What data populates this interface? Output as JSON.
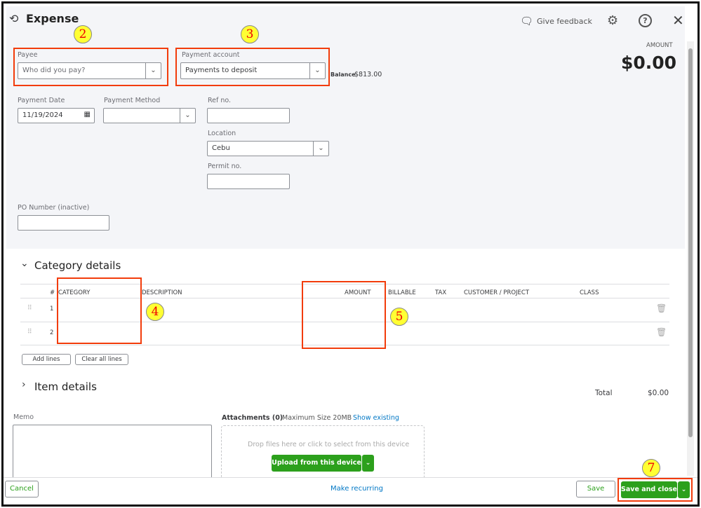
{
  "header": {
    "title": "Expense",
    "feedback": "Give feedback",
    "amount_label": "AMOUNT",
    "amount": "$0.00"
  },
  "form": {
    "payee": {
      "label": "Payee",
      "placeholder": "Who did you pay?"
    },
    "payment_account": {
      "label": "Payment account",
      "value": "Payments to deposit",
      "balance_label": "Balance",
      "balance": "$813.00"
    },
    "payment_date": {
      "label": "Payment Date",
      "value": "11/19/2024"
    },
    "payment_method": {
      "label": "Payment Method",
      "value": ""
    },
    "ref_no": {
      "label": "Ref no.",
      "value": ""
    },
    "location": {
      "label": "Location",
      "value": "Cebu"
    },
    "permit_no": {
      "label": "Permit no.",
      "value": ""
    },
    "po_number": {
      "label": "PO Number (inactive)",
      "value": ""
    }
  },
  "category_details": {
    "title": "Category details",
    "columns": [
      "#",
      "CATEGORY",
      "DESCRIPTION",
      "AMOUNT",
      "BILLABLE",
      "TAX",
      "CUSTOMER / PROJECT",
      "CLASS"
    ],
    "rows": [
      {
        "num": "1"
      },
      {
        "num": "2"
      }
    ],
    "add_lines": "Add lines",
    "clear_lines": "Clear all lines"
  },
  "item_details": {
    "title": "Item details"
  },
  "total": {
    "label": "Total",
    "value": "$0.00"
  },
  "memo": {
    "label": "Memo"
  },
  "attachments": {
    "label": "Attachments (0)",
    "max_size": "Maximum Size 20MB",
    "show_existing": "Show existing",
    "drop_text": "Drop files here or click to select from this device",
    "upload": "Upload from this device"
  },
  "footer": {
    "cancel": "Cancel",
    "make_recurring": "Make recurring",
    "save": "Save",
    "save_close": "Save and close"
  },
  "annotations": [
    "2",
    "3",
    "4",
    "5",
    "7"
  ],
  "colors": {
    "accent_green": "#2ca01c",
    "highlight": "#f23c0b",
    "badge": "#ffff33",
    "link": "#0077c5"
  }
}
